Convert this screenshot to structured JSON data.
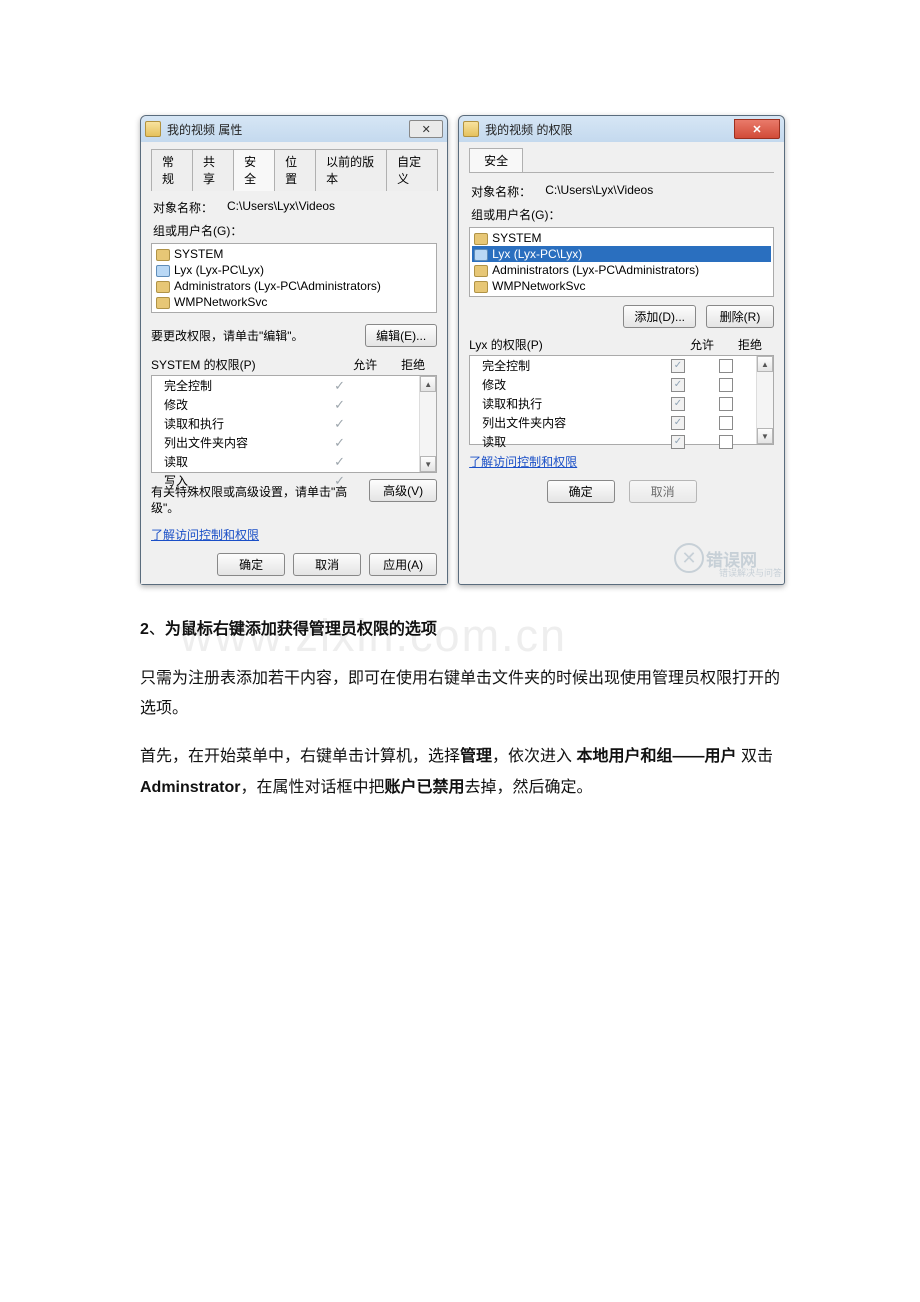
{
  "left_dialog": {
    "title": "我的视频 属性",
    "close_glyph": "✕",
    "tabs": [
      "常规",
      "共享",
      "安全",
      "位置",
      "以前的版本",
      "自定义"
    ],
    "active_tab_index": 2,
    "object_label": "对象名称：",
    "object_value": "C:\\Users\\Lyx\\Videos",
    "groups_label": "组或用户名(G)：",
    "groups": [
      {
        "name": "SYSTEM",
        "type": "group"
      },
      {
        "name": "Lyx (Lyx-PC\\Lyx)",
        "type": "user"
      },
      {
        "name": "Administrators (Lyx-PC\\Administrators)",
        "type": "group"
      },
      {
        "name": "WMPNetworkSvc",
        "type": "group"
      }
    ],
    "change_hint": "要更改权限，请单击\"编辑\"。",
    "edit_btn": "编辑(E)...",
    "perm_label": "SYSTEM 的权限(P)",
    "col_allow": "允许",
    "col_deny": "拒绝",
    "permissions": [
      {
        "name": "完全控制",
        "allow": true,
        "deny": false
      },
      {
        "name": "修改",
        "allow": true,
        "deny": false
      },
      {
        "name": "读取和执行",
        "allow": true,
        "deny": false
      },
      {
        "name": "列出文件夹内容",
        "allow": true,
        "deny": false
      },
      {
        "name": "读取",
        "allow": true,
        "deny": false
      },
      {
        "name": "写入",
        "allow": true,
        "deny": false
      }
    ],
    "advanced_hint": "有关特殊权限或高级设置，请单击\"高级\"。",
    "advanced_btn": "高级(V)",
    "learn_link": "了解访问控制和权限",
    "ok_btn": "确定",
    "cancel_btn": "取消",
    "apply_btn": "应用(A)"
  },
  "right_dialog": {
    "title": "我的视频 的权限",
    "close_glyph": "✕",
    "tab": "安全",
    "object_label": "对象名称：",
    "object_value": "C:\\Users\\Lyx\\Videos",
    "groups_label": "组或用户名(G)：",
    "groups": [
      {
        "name": "SYSTEM",
        "type": "group",
        "selected": false
      },
      {
        "name": "Lyx (Lyx-PC\\Lyx)",
        "type": "user",
        "selected": true
      },
      {
        "name": "Administrators (Lyx-PC\\Administrators)",
        "type": "group",
        "selected": false
      },
      {
        "name": "WMPNetworkSvc",
        "type": "group",
        "selected": false
      }
    ],
    "add_btn": "添加(D)...",
    "remove_btn": "删除(R)",
    "perm_label": "Lyx 的权限(P)",
    "col_allow": "允许",
    "col_deny": "拒绝",
    "permissions": [
      {
        "name": "完全控制",
        "allow": true,
        "deny": false
      },
      {
        "name": "修改",
        "allow": true,
        "deny": false
      },
      {
        "name": "读取和执行",
        "allow": true,
        "deny": false
      },
      {
        "name": "列出文件夹内容",
        "allow": true,
        "deny": false
      },
      {
        "name": "读取",
        "allow": true,
        "deny": false
      }
    ],
    "learn_link": "了解访问控制和权限",
    "ok_btn": "确定",
    "cancel_btn": "取消",
    "stamp_text": "错误网",
    "stamp_sub": "错误解决与问答"
  },
  "article": {
    "section_num": "2",
    "section_sep": "、",
    "section_title": "为鼠标右键添加获得管理员权限的选项",
    "p1": "只需为注册表添加若干内容，即可在使用右键单击文件夹的时候出现使用管理员权限打开的选项。",
    "p2_pre": "首先，在开始菜单中，右键单击计算机，选择",
    "p2_b1": "管理",
    "p2_mid1": "，依次进入 ",
    "p2_b2": "本地用户和组——用户",
    "p2_mid2": " 双击 ",
    "p2_b3": "Adminstrator",
    "p2_mid3": "，在属性对话框中把",
    "p2_b4": "账户已禁用",
    "p2_end": "去掉，然后确定。"
  },
  "watermark": "www.zixin.com.cn"
}
